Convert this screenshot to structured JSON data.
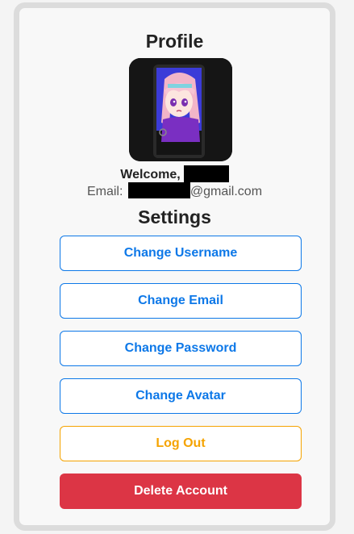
{
  "profile": {
    "title": "Profile",
    "welcome_label": "Welcome,",
    "email_label": "Email:",
    "email_suffix": "@gmail.com"
  },
  "settings": {
    "title": "Settings",
    "buttons": [
      {
        "label": "Change Username"
      },
      {
        "label": "Change Email"
      },
      {
        "label": "Change Password"
      },
      {
        "label": "Change Avatar"
      },
      {
        "label": "Log Out"
      },
      {
        "label": "Delete Account"
      }
    ]
  },
  "colors": {
    "primary": "#0d78e8",
    "warning": "#f5a300",
    "danger": "#dc3545"
  }
}
